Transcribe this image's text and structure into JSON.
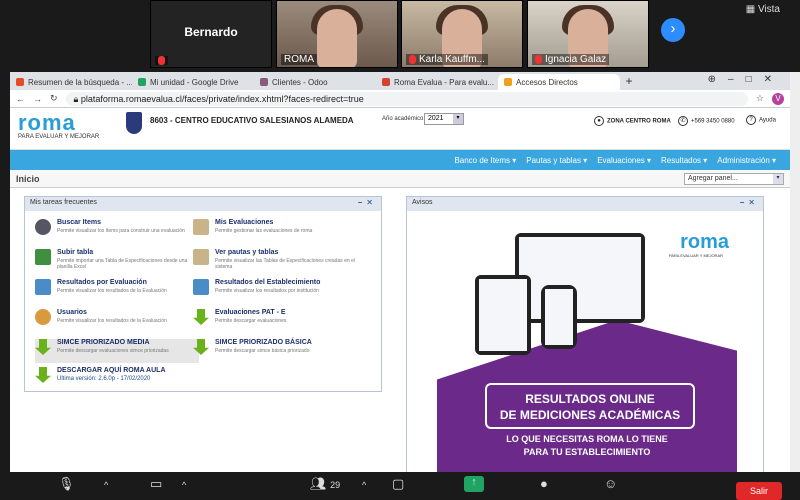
{
  "zoom": {
    "participants": [
      {
        "name": "Bernardo",
        "type": "no-video"
      },
      {
        "name": "ROMA",
        "type": "video"
      },
      {
        "name": "Karla Kauffm...",
        "type": "video"
      },
      {
        "name": "Ignacia Galaz",
        "type": "video"
      }
    ],
    "view_label": "Vista",
    "participants_count": "29",
    "leave_label": "Salir"
  },
  "browser": {
    "tabs": [
      {
        "label": "Resumen de la búsqueda - ...",
        "color": "#e34c26"
      },
      {
        "label": "Mi unidad - Google Drive",
        "color": "#1fa463"
      },
      {
        "label": "Clientes - Odoo",
        "color": "#875a7b"
      },
      {
        "label": "Roma Evalua - Para evalu...",
        "color": "#d6402e"
      },
      {
        "label": "Accesos Directos",
        "color": "#f0a020"
      }
    ],
    "url": "plataforma.romaevalua.cl/faces/private/index.xhtml?faces-redirect=true",
    "avatar_letter": "V"
  },
  "site": {
    "logo_word": "roma",
    "logo_tag": "PARA EVALUAR Y MEJORAR",
    "school": "8603 - CENTRO EDUCATIVO SALESIANOS ALAMEDA",
    "year_label": "Año académico:",
    "year_value": "2021",
    "zona": "ZONA CENTRO ROMA",
    "phone": "+569 3450 0880",
    "help": "Ayuda",
    "nav": [
      "Banco de Items ▾",
      "Pautas y tablas ▾",
      "Evaluaciones ▾",
      "Resultados ▾",
      "Administración ▾"
    ],
    "section_title": "Inicio",
    "panel_select": "Agregar panel..."
  },
  "tareas": {
    "title": "Mis tareas frecuentes",
    "items": [
      {
        "title": "Buscar Items",
        "desc": "Permite visualizar los ítems para construir una evaluación"
      },
      {
        "title": "Mis Evaluaciones",
        "desc": "Permite gestionar las evaluaciones de roma"
      },
      {
        "title": "Subir tabla",
        "desc": "Permite importar una Tabla de Especificaciones desde una planilla Excel"
      },
      {
        "title": "Ver pautas y tablas",
        "desc": "Permite visualizar las Tablas de Especificaciones creadas en el sistema"
      },
      {
        "title": "Resultados por Evaluación",
        "desc": "Permite visualizar los resultados de la Evaluación"
      },
      {
        "title": "Resultados del Establecimiento",
        "desc": "Permite visualizar los resultados por institución"
      },
      {
        "title": "Usuarios",
        "desc": "Permite visualizar los resultados de la Evaluación"
      },
      {
        "title": "Evaluaciones PAT - E",
        "desc": "Permite descargar evaluaciones"
      },
      {
        "title": "SIMCE PRIORIZADO MEDIA",
        "desc": "Permite descargar evaluaciones simce priorizadas"
      },
      {
        "title": "SIMCE PRIORIZADO BÁSICA",
        "desc": "Permite descargar simce básica priorizado"
      },
      {
        "title": "DESCARGAR AQUÍ ROMA AULA",
        "desc": "Ultima versión: 2.6.0p - 17/02/2020"
      }
    ]
  },
  "avisos": {
    "title": "Avisos",
    "promo_logo": "roma",
    "promo_tag": "PARA EVALUAR Y MEJORAR",
    "headline1": "RESULTADOS ONLINE",
    "headline2": "DE MEDICIONES ACADÉMICAS",
    "sub1": "LO QUE NECESITAS ROMA LO TIENE",
    "sub2": "PARA TU ESTABLECIMIENTO"
  }
}
